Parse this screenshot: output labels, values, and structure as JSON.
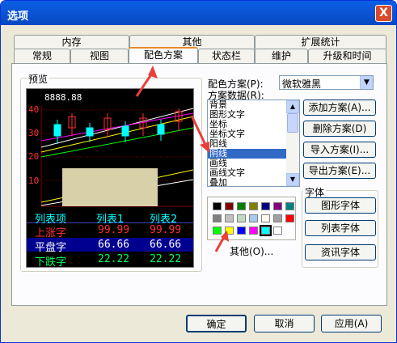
{
  "window": {
    "title": "选项",
    "close_label": "X"
  },
  "tabs_top": [
    "内存",
    "其他",
    "扩展统计"
  ],
  "tabs_bottom": [
    "常规",
    "视图",
    "配色方案",
    "状态栏",
    "维护",
    "升级和时间"
  ],
  "active_tab": "配色方案",
  "preview": {
    "label": "预览",
    "price_label": "8888.88",
    "y_ticks": [
      "40",
      "30",
      "20",
      "10"
    ],
    "table": {
      "headers": [
        "列表项",
        "列表1",
        "列表2"
      ],
      "rows": [
        {
          "label": "上涨字",
          "v1": "99.99",
          "v2": "99.99"
        },
        {
          "label": "平盘字",
          "v1": "66.66",
          "v2": "66.66"
        },
        {
          "label": "下跌字",
          "v1": "22.22",
          "v2": "22.22"
        }
      ]
    }
  },
  "scheme": {
    "label": "配色方案(P):",
    "value": "微软雅黑"
  },
  "scheme_data": {
    "label": "方案数据(R):",
    "items": [
      "背景",
      "图形文字",
      "坐标",
      "坐标文字",
      "阳线",
      "阴线",
      "画线",
      "画线文字",
      "叠加"
    ],
    "selected_index": 5
  },
  "buttons": {
    "add": "添加方案(A)...",
    "delete": "删除方案(D)",
    "import": "导入方案(I)...",
    "export": "导出方案(E)..."
  },
  "palette": {
    "colors": [
      "#000000",
      "#800000",
      "#008000",
      "#808000",
      "#000080",
      "#800080",
      "#008080",
      "#808080",
      "#c0c0c0",
      "#c0dcc0",
      "#a6caf0",
      "#fffbf0",
      "#a0a0a4",
      "#ff0000",
      "#00ff00",
      "#ffff00",
      "#0000ff",
      "#ff00ff",
      "#00ffff",
      "#ffffff"
    ],
    "selected_index": 18,
    "other_label": "其他(O)..."
  },
  "fonts": {
    "label": "字体",
    "graph": "图形字体",
    "list": "列表字体",
    "info": "资讯字体"
  },
  "footer": {
    "ok": "确定",
    "cancel": "取消",
    "apply": "应用(A)"
  },
  "annotation_color": "#e8403a"
}
